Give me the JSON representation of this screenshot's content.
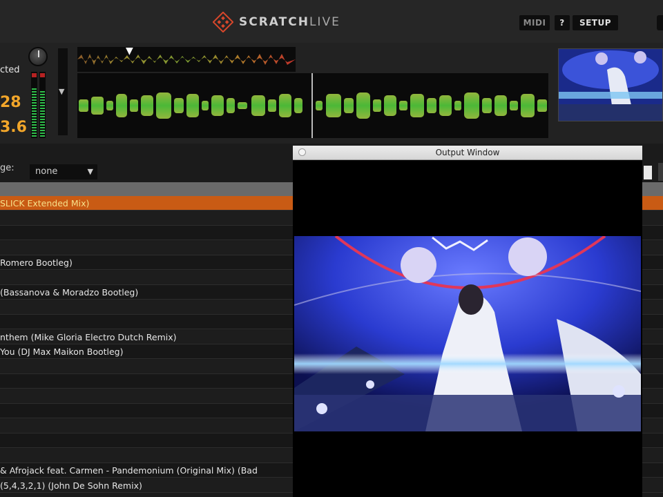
{
  "app": {
    "brand_main": "SCRATCH",
    "brand_live": "LIVE",
    "buttons": {
      "midi": "MIDI",
      "help": "?",
      "setup": "SETUP"
    }
  },
  "deck": {
    "status_text": "cted",
    "bpm_primary": "28",
    "bpm_secondary": "3.6",
    "overview_marker": "▼",
    "slider_arrow": "▼"
  },
  "library": {
    "filter_label": "ge:",
    "filter_value": "none",
    "filter_chevron": "▼",
    "rows": [
      {
        "text": "SLICK Extended Mix)",
        "selected": true
      },
      {
        "text": ""
      },
      {
        "text": ""
      },
      {
        "text": ""
      },
      {
        "text": "Romero Bootleg)"
      },
      {
        "text": ""
      },
      {
        "text": "(Bassanova & Moradzo Bootleg)"
      },
      {
        "text": ""
      },
      {
        "text": ""
      },
      {
        "text": "nthem (Mike Gloria Electro Dutch Remix)"
      },
      {
        "text": "You (DJ Max Maikon Bootleg)"
      },
      {
        "text": ""
      },
      {
        "text": ""
      },
      {
        "text": ""
      },
      {
        "text": ""
      },
      {
        "text": ""
      },
      {
        "text": ""
      },
      {
        "text": ""
      },
      {
        "text": " & Afrojack feat. Carmen - Pandemonium (Original Mix) (Bad"
      },
      {
        "text": "(5,4,3,2,1) (John De Sohn Remix)"
      }
    ]
  },
  "output_window": {
    "title": "Output Window"
  },
  "colors": {
    "accent_orange": "#c95b14",
    "bpm_orange": "#f2a62a",
    "selected_text": "#f6e08a"
  }
}
